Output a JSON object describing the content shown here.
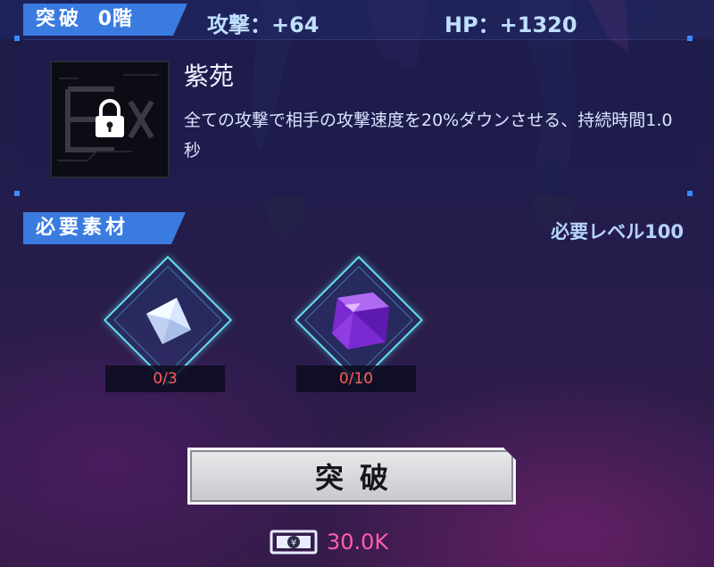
{
  "breakthrough": {
    "tag_label": "突破",
    "stage_label": "0階",
    "attack_stat": "攻撃：+64",
    "hp_stat": "HP：+1320"
  },
  "skill": {
    "icon": "lock-icon",
    "name": "紫苑",
    "description": "全ての攻撃で相手の攻撃速度を20%ダウンさせる、持続時間1.0秒"
  },
  "materials": {
    "section_label": "必要素材",
    "required_level": "必要レベル100",
    "items": [
      {
        "icon": "silver-crystal-icon",
        "count": "0/3"
      },
      {
        "icon": "purple-gem-icon",
        "count": "0/10"
      }
    ]
  },
  "action": {
    "button_label": "突破",
    "cost_icon": "currency-icon",
    "cost_value": "30.0K"
  },
  "colors": {
    "accent_blue": "#3a7be0",
    "cyan_frame": "#63e0e8",
    "count_red": "#ff5a5a",
    "cost_pink": "#ff5fa8"
  }
}
